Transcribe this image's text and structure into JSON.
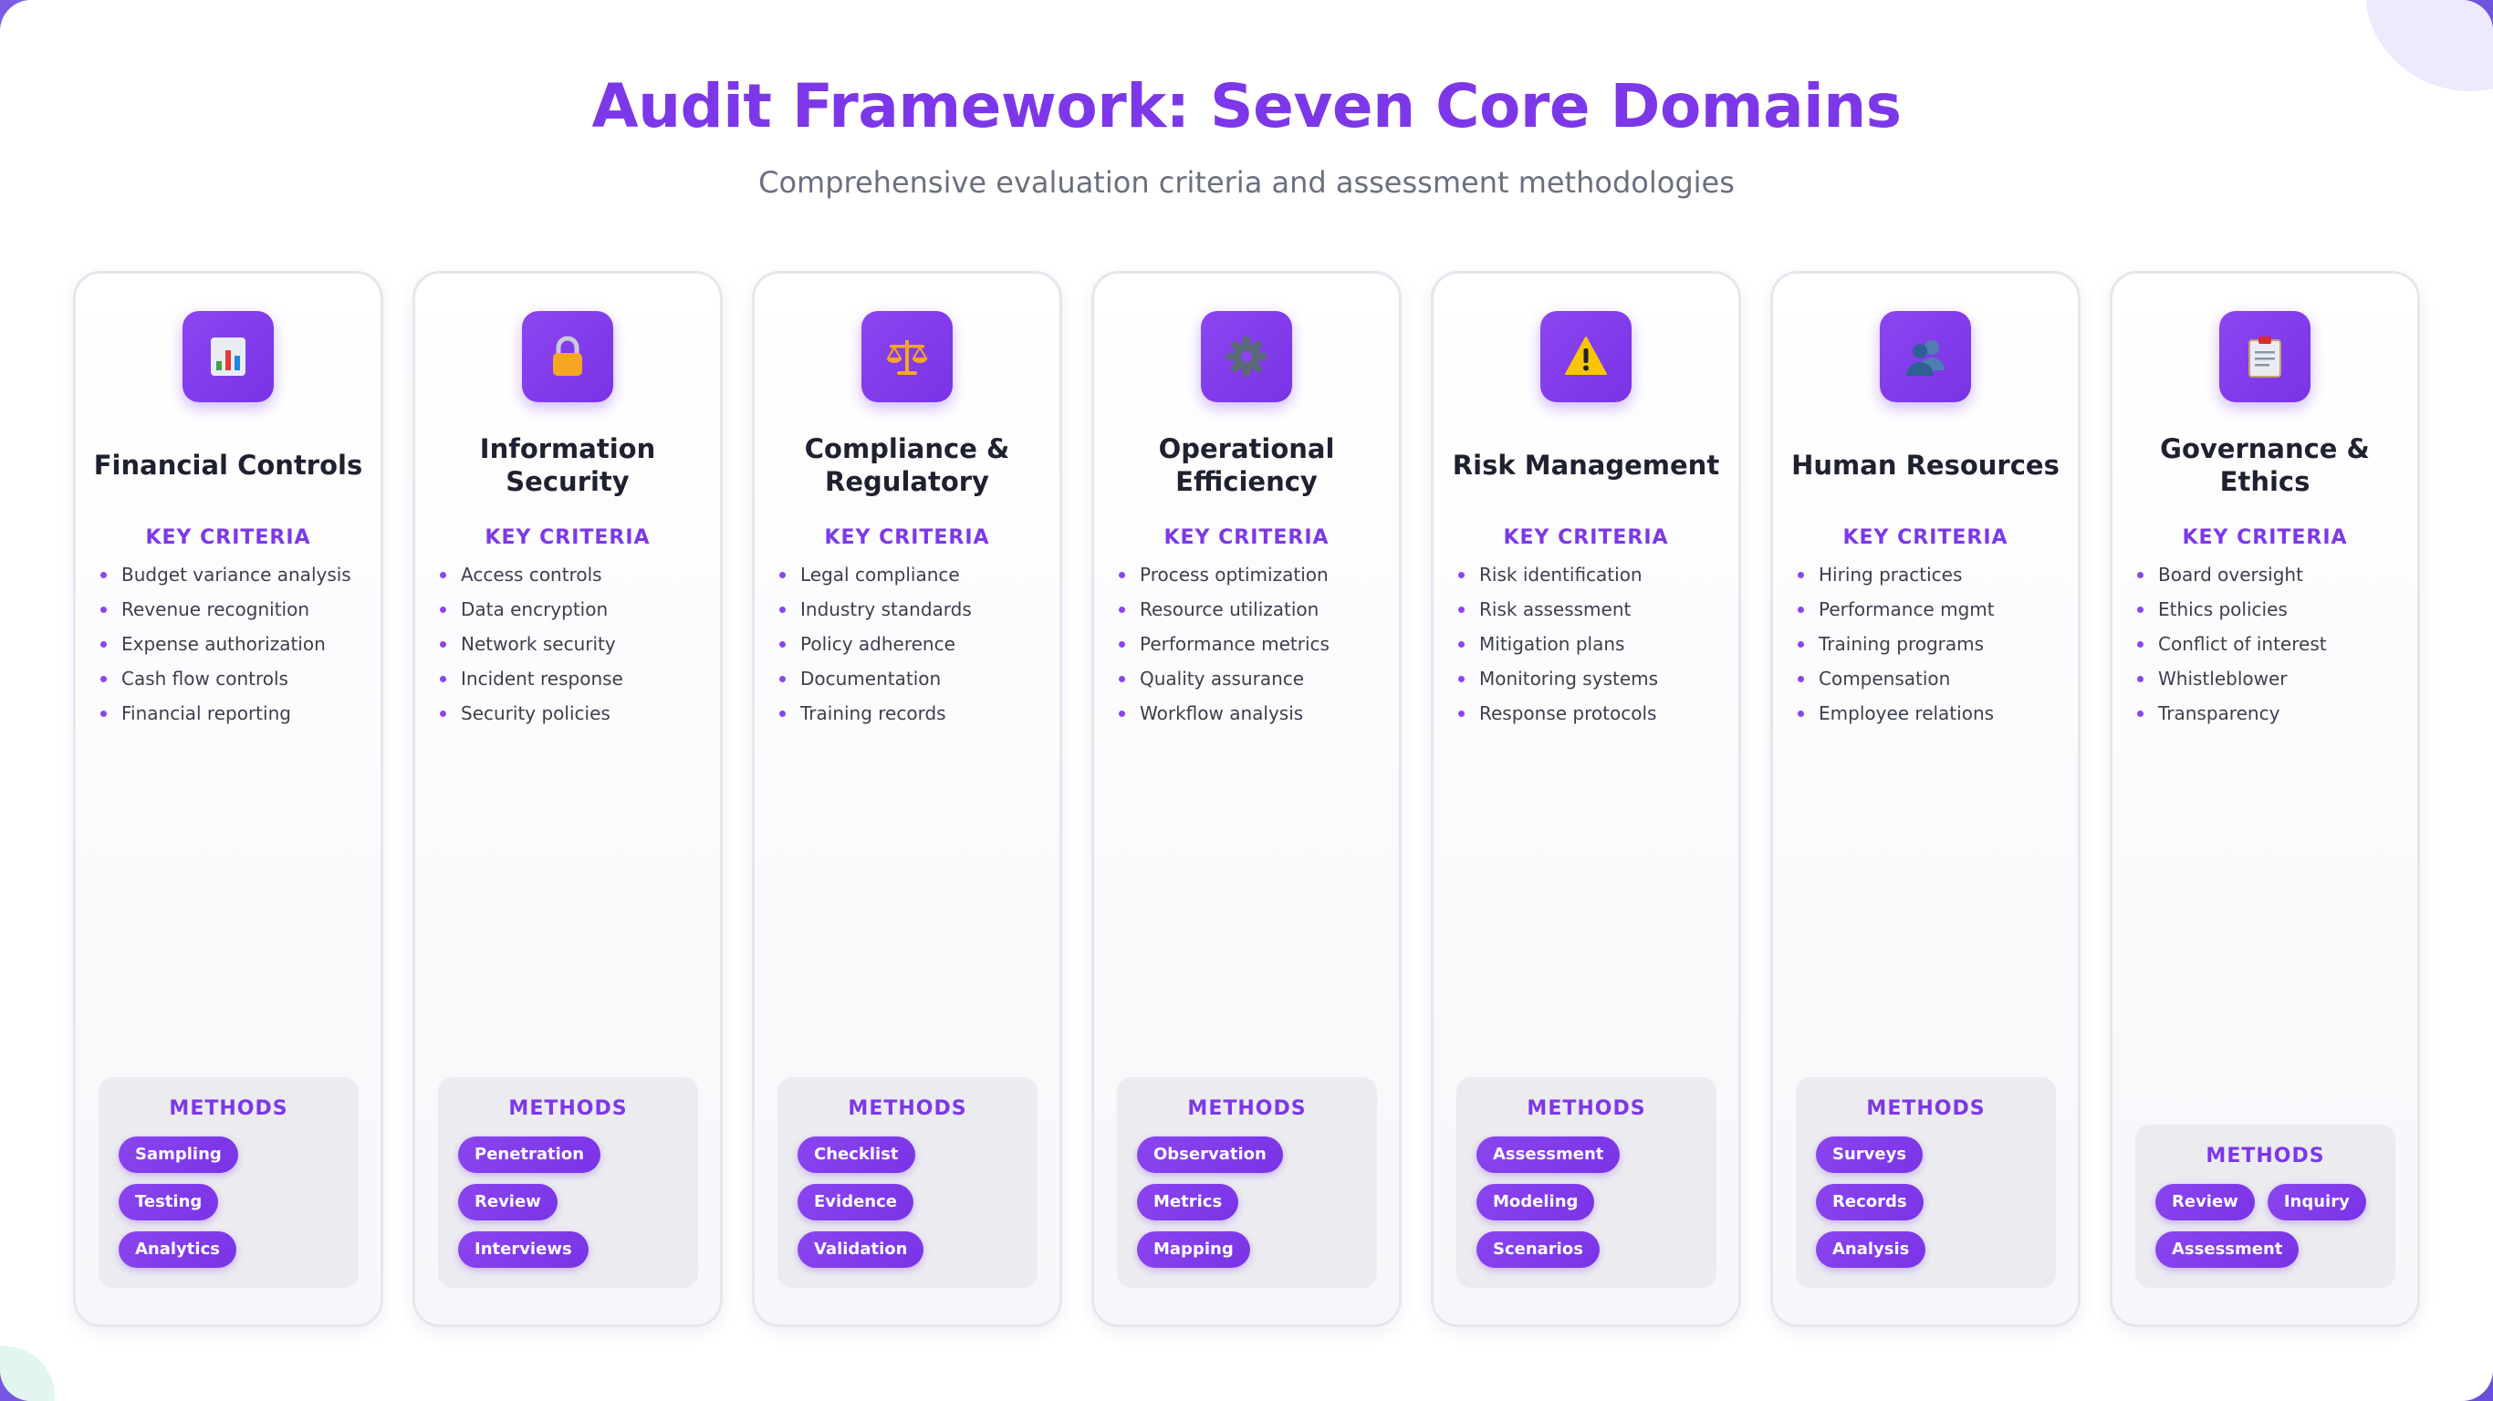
{
  "header": {
    "title": "Audit Framework: Seven Core Domains",
    "subtitle": "Comprehensive evaluation criteria and assessment methodologies"
  },
  "labels": {
    "criteria": "KEY CRITERIA",
    "methods": "METHODS"
  },
  "domains": [
    {
      "icon": "bar-chart-icon",
      "title": "Financial Controls",
      "criteria": [
        "Budget variance analysis",
        "Revenue recognition",
        "Expense authorization",
        "Cash flow controls",
        "Financial reporting"
      ],
      "methods": [
        "Sampling",
        "Testing",
        "Analytics"
      ]
    },
    {
      "icon": "lock-icon",
      "title": "Information Security",
      "criteria": [
        "Access controls",
        "Data encryption",
        "Network security",
        "Incident response",
        "Security policies"
      ],
      "methods": [
        "Penetration",
        "Review",
        "Interviews"
      ]
    },
    {
      "icon": "scales-icon",
      "title": "Compliance & Regulatory",
      "criteria": [
        "Legal compliance",
        "Industry standards",
        "Policy adherence",
        "Documentation",
        "Training records"
      ],
      "methods": [
        "Checklist",
        "Evidence",
        "Validation"
      ]
    },
    {
      "icon": "gear-icon",
      "title": "Operational Efficiency",
      "criteria": [
        "Process optimization",
        "Resource utilization",
        "Performance metrics",
        "Quality assurance",
        "Workflow analysis"
      ],
      "methods": [
        "Observation",
        "Metrics",
        "Mapping"
      ]
    },
    {
      "icon": "warning-icon",
      "title": "Risk Management",
      "criteria": [
        "Risk identification",
        "Risk assessment",
        "Mitigation plans",
        "Monitoring systems",
        "Response protocols"
      ],
      "methods": [
        "Assessment",
        "Modeling",
        "Scenarios"
      ]
    },
    {
      "icon": "people-icon",
      "title": "Human Resources",
      "criteria": [
        "Hiring practices",
        "Performance mgmt",
        "Training programs",
        "Compensation",
        "Employee relations"
      ],
      "methods": [
        "Surveys",
        "Records",
        "Analysis"
      ]
    },
    {
      "icon": "clipboard-icon",
      "title": "Governance & Ethics",
      "criteria": [
        "Board oversight",
        "Ethics policies",
        "Conflict of interest",
        "Whistleblower",
        "Transparency"
      ],
      "methods": [
        "Review",
        "Inquiry",
        "Assessment"
      ]
    }
  ]
}
